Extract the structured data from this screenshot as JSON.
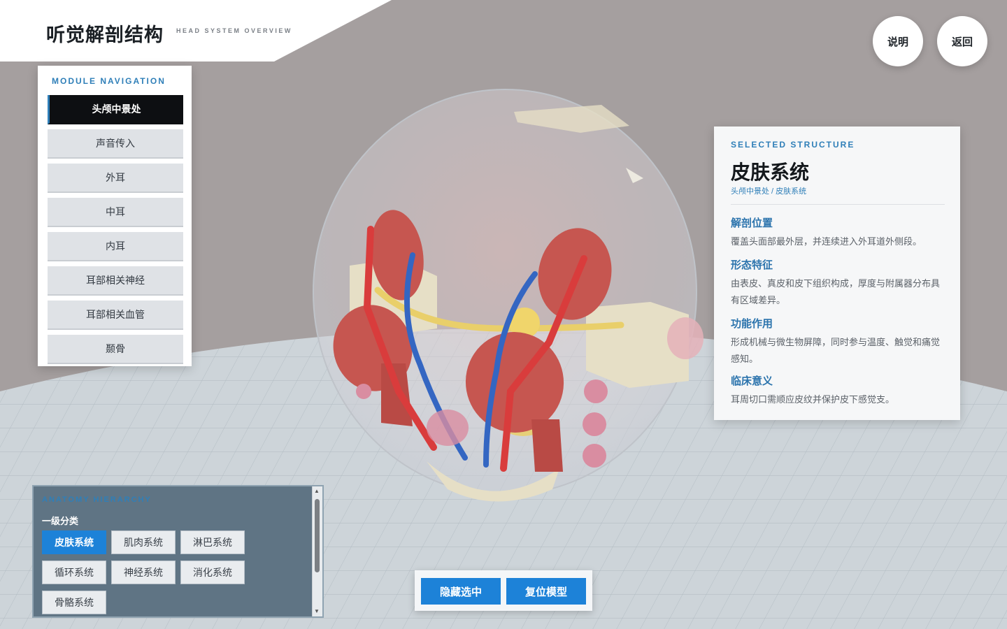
{
  "header": {
    "title": "听觉解剖结构",
    "subtitle": "HEAD SYSTEM OVERVIEW"
  },
  "top_buttons": {
    "help": "说明",
    "back": "返回"
  },
  "module_nav": {
    "heading": "MODULE NAVIGATION",
    "items": [
      {
        "label": "头颅中景处",
        "active": true
      },
      {
        "label": "声音传入",
        "active": false
      },
      {
        "label": "外耳",
        "active": false
      },
      {
        "label": "中耳",
        "active": false
      },
      {
        "label": "内耳",
        "active": false
      },
      {
        "label": "耳部相关神经",
        "active": false
      },
      {
        "label": "耳部相关血管",
        "active": false
      },
      {
        "label": "颞骨",
        "active": false
      }
    ]
  },
  "info_panel": {
    "heading": "SELECTED STRUCTURE",
    "title": "皮肤系统",
    "path": "头颅中景处 / 皮肤系统",
    "sections": [
      {
        "heading": "解剖位置",
        "text": "覆盖头面部最外层，并连续进入外耳道外侧段。"
      },
      {
        "heading": "形态特征",
        "text": "由表皮、真皮和皮下组织构成，厚度与附属器分布具有区域差异。"
      },
      {
        "heading": "功能作用",
        "text": "形成机械与微生物屏障，同时参与温度、触觉和痛觉感知。"
      },
      {
        "heading": "临床意义",
        "text": "耳周切口需顺应皮纹并保护皮下感觉支。"
      }
    ]
  },
  "hierarchy": {
    "heading": "ANATOMY HIERARCHY",
    "level_label": "一级分类",
    "chips": [
      {
        "label": "皮肤系统",
        "active": true
      },
      {
        "label": "肌肉系统",
        "active": false
      },
      {
        "label": "淋巴系统",
        "active": false
      },
      {
        "label": "循环系统",
        "active": false
      },
      {
        "label": "神经系统",
        "active": false
      },
      {
        "label": "消化系统",
        "active": false
      },
      {
        "label": "骨骼系统",
        "active": false
      }
    ]
  },
  "actions": {
    "hide_selected": "隐藏选中",
    "reset_model": "复位模型"
  },
  "colors": {
    "accent": "#1d82d8",
    "heading_blue": "#2f7fb8",
    "background": "#a59f9f",
    "grid_floor": "#c9d1d6",
    "muscle": "#c65650",
    "artery": "#d93c3c",
    "vein": "#3466c2",
    "nerve": "#e9cf6a",
    "bone": "#e6dfc6",
    "lymph": "#d98da1"
  }
}
